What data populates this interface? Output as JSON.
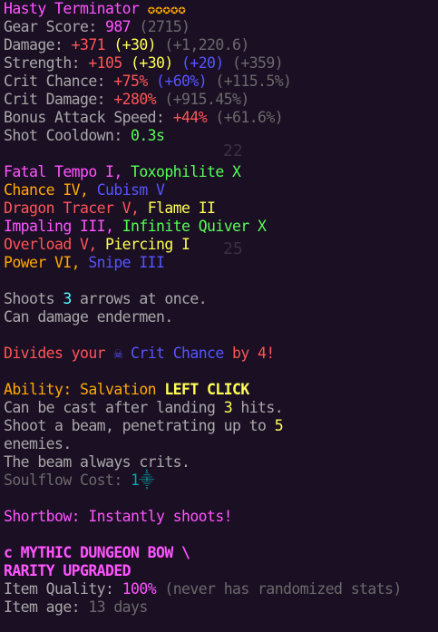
{
  "item": {
    "name": "Hasty Terminator",
    "stars": "✪✪✪✪✪"
  },
  "stats": {
    "gear_score_label": "Gear Score: ",
    "gear_score": "987",
    "gear_score_extra": " (2715)",
    "damage_label": "Damage: ",
    "damage": "+371",
    "damage_bonus": " (+30)",
    "damage_extra": " (+1,220.6)",
    "strength_label": "Strength: ",
    "strength": "+105",
    "strength_bonus": " (+30)",
    "strength_blue": " (+20)",
    "strength_extra": " (+359)",
    "crit_chance_label": "Crit Chance: ",
    "crit_chance": "+75%",
    "crit_chance_blue": " (+60%)",
    "crit_chance_extra": " (+115.5%)",
    "crit_damage_label": "Crit Damage: ",
    "crit_damage": "+280%",
    "crit_damage_extra": " (+915.45%)",
    "bas_label": "Bonus Attack Speed: ",
    "bas": "+44%",
    "bas_extra": " (+61.6%)",
    "shot_cd_label": "Shot Cooldown: ",
    "shot_cd": "0.3s"
  },
  "enchants": [
    {
      "a": "Fatal Tempo I, ",
      "b": "Toxophilite X"
    },
    {
      "a": "Chance IV, ",
      "b": "Cubism V"
    },
    {
      "a": "Dragon Tracer V, ",
      "b": "Flame II"
    },
    {
      "a": "Impaling III, ",
      "b": "Infinite Quiver X"
    },
    {
      "a": "Overload V, ",
      "b": "Piercing I"
    },
    {
      "a": "Power VI, ",
      "b": "Snipe III"
    }
  ],
  "desc": {
    "shoots_a": "Shoots ",
    "shoots_n": "3",
    "shoots_b": " arrows at once.",
    "ender": "Can damage endermen.",
    "divides_a": "Divides your ",
    "divides_icon": "☠",
    "divides_b": " Crit Chance",
    "divides_c": " by 4!"
  },
  "ability": {
    "label": "Ability: Salvation ",
    "click": "LEFT CLICK",
    "l1a": "Can be cast after landing ",
    "l1n": "3",
    "l1b": " hits.",
    "l2a": "Shoot a beam, penetrating up to ",
    "l2n": "5",
    "l3": "enemies.",
    "l4": "The beam always crits.",
    "soulflow_label": "Soulflow Cost: ",
    "soulflow": "1⸎"
  },
  "shortbow": "Shortbow: Instantly shoots!",
  "rarity": {
    "line1": "c MYTHIC DUNGEON BOW \\",
    "line2": "RARITY UPGRADED"
  },
  "quality": {
    "label": "Item Quality: ",
    "value": "100%",
    "note": " (never has randomized stats)"
  },
  "age": {
    "label": "Item age: ",
    "value": "13 days"
  },
  "background_digits": {
    "a": "22",
    "b": "25"
  }
}
